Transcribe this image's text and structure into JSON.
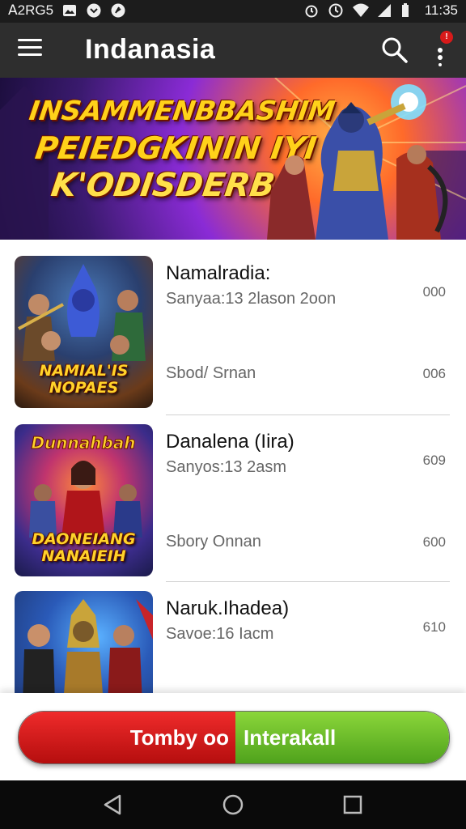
{
  "status_bar": {
    "carrier": "ꓮ2RG5",
    "time": "11:35"
  },
  "app_bar": {
    "title": "Indanasia",
    "notification_badge": "!"
  },
  "banner": {
    "lines": [
      "INSAMMENBBASHIM",
      "PEIEDGKININ IYI",
      "K'ODISDERB!"
    ]
  },
  "items": [
    {
      "title": "Namalradia:",
      "subtitle": "Sanyaa:13 2lason 2oon",
      "meta": "Sbod/ Srnan",
      "value_top": "000",
      "value_bottom": "006",
      "thumb_caption": "NAMIAL'IS NOPAES"
    },
    {
      "title": "Danalena (Iira)",
      "subtitle": "Sanyos:13 2asm",
      "meta": "Sbory Onnan",
      "value_top": "609",
      "value_bottom": "600",
      "thumb_caption": "DAONEIANG NANAIEIH"
    },
    {
      "title": "Naruk.Ihadea)",
      "subtitle": "Savoe:16 Iacm",
      "meta": "",
      "value_top": "610",
      "value_bottom": "",
      "thumb_caption": ""
    }
  ],
  "action": {
    "left_label": "Tomby oo",
    "right_label": "Interakall"
  }
}
